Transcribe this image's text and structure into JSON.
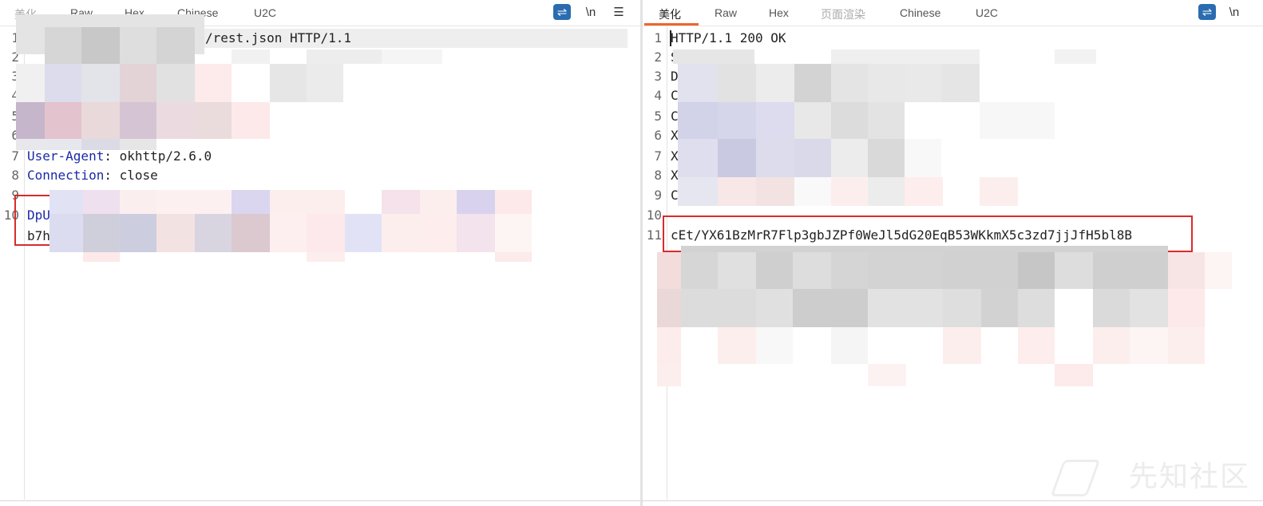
{
  "left_tabs": [
    "美化",
    "Raw",
    "Hex",
    "Chinese",
    "U2C"
  ],
  "right_tabs": [
    "美化",
    "Raw",
    "Hex",
    "页面渲染",
    "Chinese",
    "U2C"
  ],
  "toolbar": {
    "wrap_icon": "wrap-lines-icon",
    "newline_label": "\\n",
    "menu_label": "☰"
  },
  "request": {
    "line_numbers": [
      "1",
      "2",
      "3",
      "4",
      "5",
      "6",
      "7",
      "8",
      "9",
      "10"
    ],
    "line1_tail": "/rest.json HTTP/1.1",
    "ua_key": "User-Agent",
    "ua_value": ": okhttp/2.6.0",
    "conn_key": "Connection",
    "conn_value": ": close",
    "body_start": "DpU",
    "body_second": "b7h"
  },
  "response": {
    "line_numbers": [
      "1",
      "2",
      "3",
      "4",
      "5",
      "6",
      "7",
      "8",
      "9",
      "10",
      "11"
    ],
    "status_line": "HTTP/1.1 200 OK",
    "visible_line_starts": [
      "S",
      "D",
      "C",
      "C",
      "X",
      "X",
      "X",
      "C"
    ],
    "body_line": "cEt/YX61BzMrR7Flp3gbJZPf0WeJl5dG20EqB53WKkmX5c3zd7jjJfH5bl8B"
  },
  "watermark": "先知社区",
  "colors": {
    "accent": "#f0642c",
    "redbox": "#d92b2b",
    "header_key": "#1a2aa8",
    "wrap_icon_bg": "#2b6cb0"
  }
}
